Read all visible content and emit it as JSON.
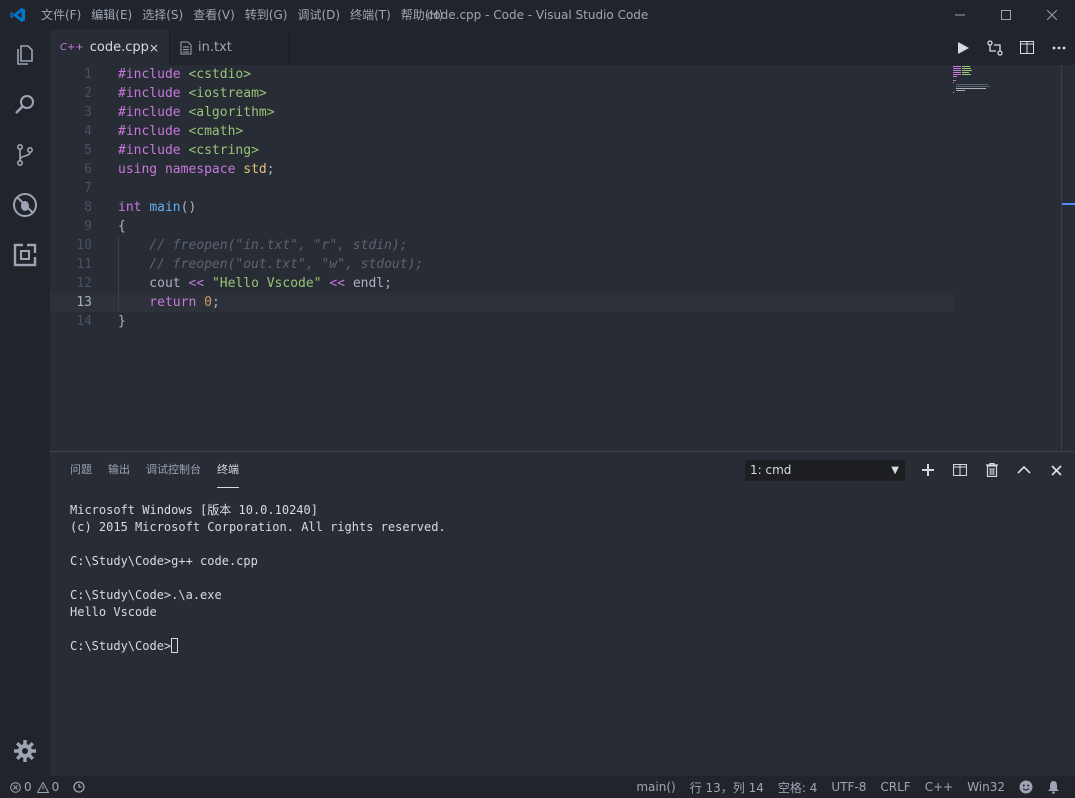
{
  "window": {
    "title": "code.cpp - Code - Visual Studio Code"
  },
  "menu": [
    "文件(F)",
    "编辑(E)",
    "选择(S)",
    "查看(V)",
    "转到(G)",
    "调试(D)",
    "终端(T)",
    "帮助(H)"
  ],
  "tabs": [
    {
      "icon": "C++",
      "label": "code.cpp",
      "close": "×"
    },
    {
      "label": "in.txt"
    }
  ],
  "editor": {
    "line_numbers": [
      "1",
      "2",
      "3",
      "4",
      "5",
      "6",
      "7",
      "8",
      "9",
      "10",
      "11",
      "12",
      "13",
      "14"
    ],
    "current_line": 13
  },
  "panel": {
    "tabs": [
      "问题",
      "输出",
      "调试控制台",
      "终端"
    ],
    "active_tab": "终端",
    "terminal_select": "1: cmd",
    "terminal_lines": [
      "Microsoft Windows [版本 10.0.10240]",
      "(c) 2015 Microsoft Corporation. All rights reserved.",
      "",
      "C:\\Study\\Code>g++ code.cpp",
      "",
      "C:\\Study\\Code>.\\a.exe",
      "Hello Vscode",
      "",
      "C:\\Study\\Code>"
    ]
  },
  "status": {
    "errors": "0",
    "warnings": "0",
    "function": "main()",
    "position": "行 13，列 14",
    "indent": "空格: 4",
    "encoding": "UTF-8",
    "eol": "CRLF",
    "language": "C++",
    "platform": "Win32"
  },
  "colors": {
    "accent": "#528bff",
    "keyword": "#c678dd",
    "string": "#98c379",
    "function": "#61afef",
    "number": "#d19a66",
    "comment": "#5c6370",
    "vscode_blue": "#007acc"
  }
}
